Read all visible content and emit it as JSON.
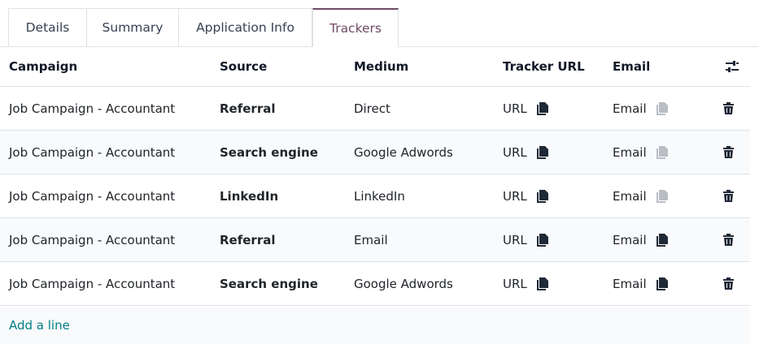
{
  "tabs": [
    {
      "label": "Details",
      "active": false
    },
    {
      "label": "Summary",
      "active": false
    },
    {
      "label": "Application Info",
      "active": false
    },
    {
      "label": "Trackers",
      "active": true
    }
  ],
  "table": {
    "columns": [
      "Campaign",
      "Source",
      "Medium",
      "Tracker URL",
      "Email"
    ],
    "settings_icon": "sliders-icon",
    "rows": [
      {
        "campaign": "Job Campaign - Accountant",
        "source": "Referral",
        "medium": "Direct",
        "tracker_url": "URL",
        "email": "Email",
        "email_copy_enabled": false
      },
      {
        "campaign": "Job Campaign - Accountant",
        "source": "Search engine",
        "medium": "Google Adwords",
        "tracker_url": "URL",
        "email": "Email",
        "email_copy_enabled": false
      },
      {
        "campaign": "Job Campaign - Accountant",
        "source": "LinkedIn",
        "medium": "LinkedIn",
        "tracker_url": "URL",
        "email": "Email",
        "email_copy_enabled": false
      },
      {
        "campaign": "Job Campaign - Accountant",
        "source": "Referral",
        "medium": "Email",
        "tracker_url": "URL",
        "email": "Email",
        "email_copy_enabled": true
      },
      {
        "campaign": "Job Campaign - Accountant",
        "source": "Search engine",
        "medium": "Google Adwords",
        "tracker_url": "URL",
        "email": "Email",
        "email_copy_enabled": true
      }
    ]
  },
  "add_line": "Add a line",
  "colors": {
    "accent": "#714b67",
    "link": "#017e84",
    "row_alt": "#f9fafb",
    "border": "#dee2e6"
  }
}
